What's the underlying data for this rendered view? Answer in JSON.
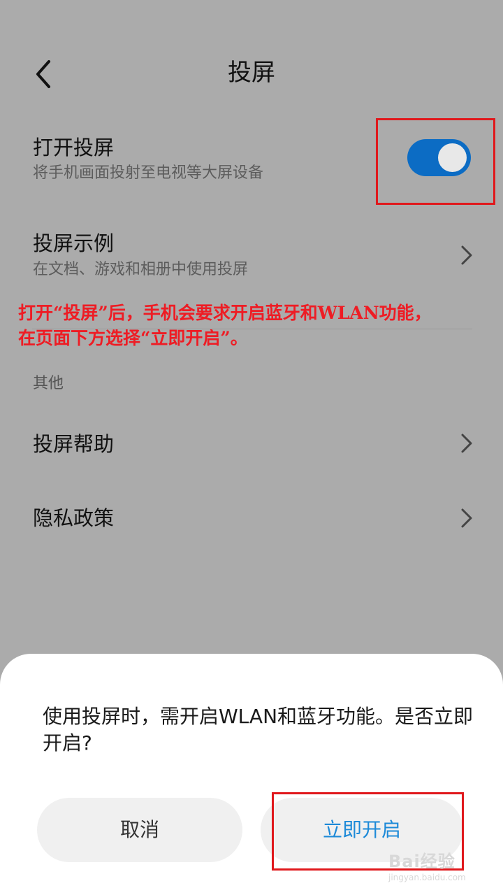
{
  "header": {
    "title": "投屏"
  },
  "settings": {
    "cast_toggle": {
      "title": "打开投屏",
      "subtitle": "将手机画面投射至电视等大屏设备",
      "enabled": true
    },
    "cast_examples": {
      "title": "投屏示例",
      "subtitle": "在文档、游戏和相册中使用投屏"
    },
    "section_other": "其他",
    "cast_help": {
      "title": "投屏帮助"
    },
    "privacy_policy": {
      "title": "隐私政策"
    }
  },
  "annotation": {
    "line1": "打开“投屏”后，手机会要求开启蓝牙和WLAN功能，",
    "line2": "在页面下方选择“立即开启”。"
  },
  "dialog": {
    "message": "使用投屏时，需开启WLAN和蓝牙功能。是否立即开启?",
    "cancel_label": "取消",
    "confirm_label": "立即开启"
  },
  "watermark": {
    "main": "Bai经验",
    "sub": "jingyan.baidu.com"
  },
  "colors": {
    "accent": "#0c6cc4",
    "annotation_red": "#ee1c24",
    "confirm_text": "#1d8ad8",
    "overlay_bg": "#ababab"
  }
}
